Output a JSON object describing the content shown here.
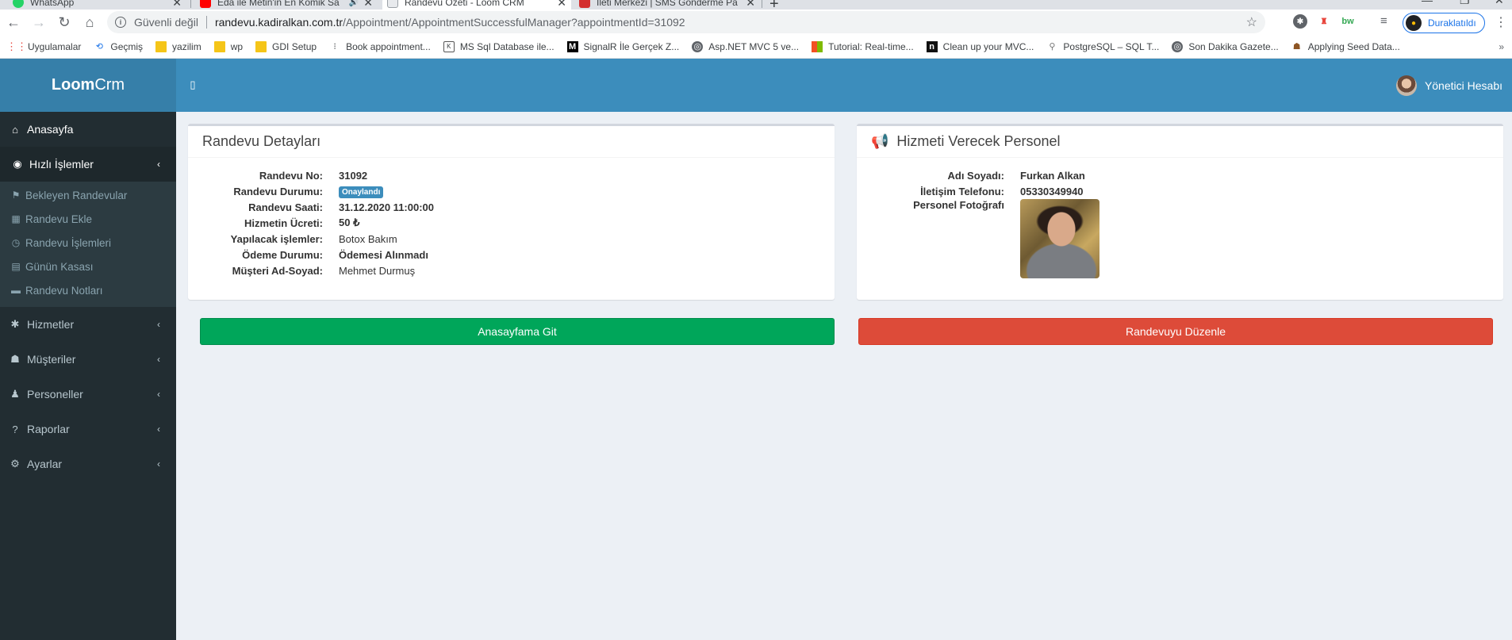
{
  "browser": {
    "tabs": [
      {
        "title": "WhatsApp",
        "icon": "whatsapp-icon",
        "color": "#25d366"
      },
      {
        "title": "Eda ile Metin'in En Komik Sa",
        "icon": "youtube-icon",
        "color": "#ff0000"
      },
      {
        "title": "Randevu Özeti - Loom CRM",
        "icon": "page-icon",
        "color": "#8ab4f8"
      },
      {
        "title": "İleti Merkezi | SMS Gönderme Pa",
        "icon": "sms-icon",
        "color": "#d32f2f"
      }
    ],
    "address": {
      "security_text": "Güvenli değil",
      "host": "randevu.kadiralkan.com.tr",
      "path": "/Appointment/AppointmentSuccessfulManager?appointmentId=31092"
    },
    "profile_label": "Duraklatıldı",
    "bookmarks": [
      {
        "label": "Uygulamalar",
        "icon": "apps-grid-icon"
      },
      {
        "label": "Geçmiş",
        "icon": "history-icon"
      },
      {
        "label": "yazilim",
        "icon": "folder-icon"
      },
      {
        "label": "wp",
        "icon": "folder-icon"
      },
      {
        "label": "GDI Setup",
        "icon": "folder-icon"
      },
      {
        "label": "Book appointment...",
        "icon": "dots-icon"
      },
      {
        "label": "MS Sql Database ile...",
        "icon": "kodlab-icon"
      },
      {
        "label": "SignalR İle Gerçek Z...",
        "icon": "medium-icon"
      },
      {
        "label": "Asp.NET MVC 5 ve...",
        "icon": "globe-icon"
      },
      {
        "label": "Tutorial: Real-time...",
        "icon": "microsoft-icon"
      },
      {
        "label": "Clean up your MVC...",
        "icon": "n-icon"
      },
      {
        "label": "PostgreSQL – SQL T...",
        "icon": "sql-icon"
      },
      {
        "label": "Son Dakika Gazete...",
        "icon": "globe-icon"
      },
      {
        "label": "Applying Seed Data...",
        "icon": "person-icon"
      }
    ]
  },
  "app": {
    "logo_bold": "Loom",
    "logo_light": "Crm",
    "user_name": "Yönetici Hesabı",
    "brand_color": "#3c8dbc"
  },
  "sidebar": {
    "items": [
      {
        "label": "Anasayfa",
        "icon": "home-icon"
      },
      {
        "label": "Hızlı İşlemler",
        "icon": "stopwatch-icon"
      },
      {
        "label": "Hizmetler",
        "icon": "asterisk-icon"
      },
      {
        "label": "Müşteriler",
        "icon": "users-icon"
      },
      {
        "label": "Personeller",
        "icon": "user-icon"
      },
      {
        "label": "Raporlar",
        "icon": "question-icon"
      },
      {
        "label": "Ayarlar",
        "icon": "cogs-icon"
      }
    ],
    "quick_actions": [
      {
        "label": "Bekleyen Randevular",
        "icon": "flag-icon"
      },
      {
        "label": "Randevu Ekle",
        "icon": "calendar-icon"
      },
      {
        "label": "Randevu İşlemleri",
        "icon": "clock-icon"
      },
      {
        "label": "Günün Kasası",
        "icon": "archive-icon"
      },
      {
        "label": "Randevu Notları",
        "icon": "note-icon"
      }
    ]
  },
  "appointment": {
    "title": "Randevu Detayları",
    "fields": {
      "no_label": "Randevu No:",
      "no_value": "31092",
      "status_label": "Randevu Durumu:",
      "status_value": "Onaylandı",
      "time_label": "Randevu Saati:",
      "time_value": "31.12.2020 11:00:00",
      "fee_label": "Hizmetin Ücreti:",
      "fee_value": "50 ₺",
      "service_label": "Yapılacak işlemler:",
      "service_value": "Botox Bakım",
      "payment_label": "Ödeme Durumu:",
      "payment_value": "Ödemesi Alınmadı",
      "customer_label": "Müşteri Ad-Soyad:",
      "customer_value": "Mehmet Durmuş"
    }
  },
  "staff": {
    "title": "Hizmeti Verecek Personel",
    "name_label": "Adı Soyadı:",
    "name_value": "Furkan Alkan",
    "phone_label": "İletişim Telefonu:",
    "phone_value": "05330349940",
    "photo_label": "Personel Fotoğrafı"
  },
  "actions": {
    "home_button": "Anasayfama Git",
    "edit_button": "Randevuyu Düzenle",
    "home_color": "#00a65a",
    "edit_color": "#dd4b39"
  }
}
